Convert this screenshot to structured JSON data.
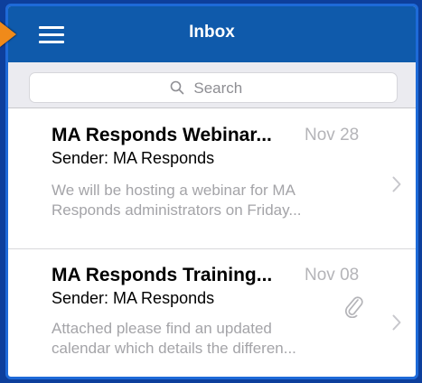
{
  "header": {
    "title": "Inbox",
    "menu_icon": "hamburger-menu-icon",
    "bar_color": "#0f5aab"
  },
  "search": {
    "placeholder": "Search",
    "icon": "search-icon"
  },
  "messages": [
    {
      "subject": "MA Responds Webinar...",
      "date": "Nov 28",
      "sender": "Sender: MA Responds",
      "preview_line1": "We will be hosting a webinar for MA",
      "preview_line2": "Responds administrators on Friday...",
      "has_attachment": false
    },
    {
      "subject": "MA Responds Training...",
      "date": "Nov 08",
      "sender": "Sender: MA Responds",
      "preview_line1": "Attached please find an updated",
      "preview_line2": "calendar which details the differen...",
      "has_attachment": true
    }
  ],
  "colors": {
    "background": "#0d3f9c",
    "frame_border": "#1e6ad8",
    "pointer": "#f08a1a"
  }
}
